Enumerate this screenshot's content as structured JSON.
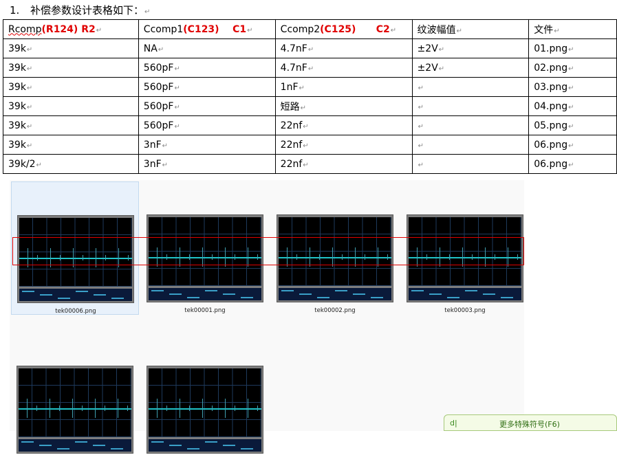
{
  "heading": {
    "number": "1.",
    "text": "补偿参数设计表格如下：",
    "mark": "↵"
  },
  "table": {
    "headers": [
      {
        "plain": "Rcomp",
        "red": "(R124) R2",
        "mark": "↵"
      },
      {
        "plain": "Ccomp1",
        "red": "(C123)    C1",
        "mark": "↵"
      },
      {
        "plain": "Ccomp2",
        "red": "(C125)      C2",
        "mark": "↵"
      },
      {
        "plain": "纹波幅值",
        "red": "",
        "mark": "↵"
      },
      {
        "plain": "文件",
        "red": "",
        "mark": "↵"
      }
    ],
    "rows": [
      [
        "39k",
        "NA",
        "4.7nF",
        "±2V",
        "01.png"
      ],
      [
        "39k",
        "560pF",
        "4.7nF",
        "±2V",
        "02.png"
      ],
      [
        "39k",
        "560pF",
        "1nF",
        "",
        "03.png"
      ],
      [
        "39k",
        "560pF",
        "短路",
        "",
        "04.png"
      ],
      [
        "39k",
        "560pF",
        "22nf",
        "",
        "05.png"
      ],
      [
        "39k",
        "3nF",
        "22nf",
        "",
        "06.png"
      ],
      [
        "39k/2",
        "3nF",
        "22nf",
        "",
        "06.png"
      ]
    ],
    "cell_mark": "↵"
  },
  "thumbnails": [
    {
      "filename": "tek00006.png",
      "selected": true
    },
    {
      "filename": "tek00001.png",
      "selected": false
    },
    {
      "filename": "tek00002.png",
      "selected": false
    },
    {
      "filename": "tek00003.png",
      "selected": false
    },
    {
      "filename": "",
      "selected": false
    },
    {
      "filename": "",
      "selected": false
    }
  ],
  "ime_bar": {
    "icon": "d|",
    "label": "更多特殊符号(F6)"
  },
  "colors": {
    "red": "#e00000",
    "trace": "#20c4c8",
    "selection": "#e8f1fb"
  }
}
